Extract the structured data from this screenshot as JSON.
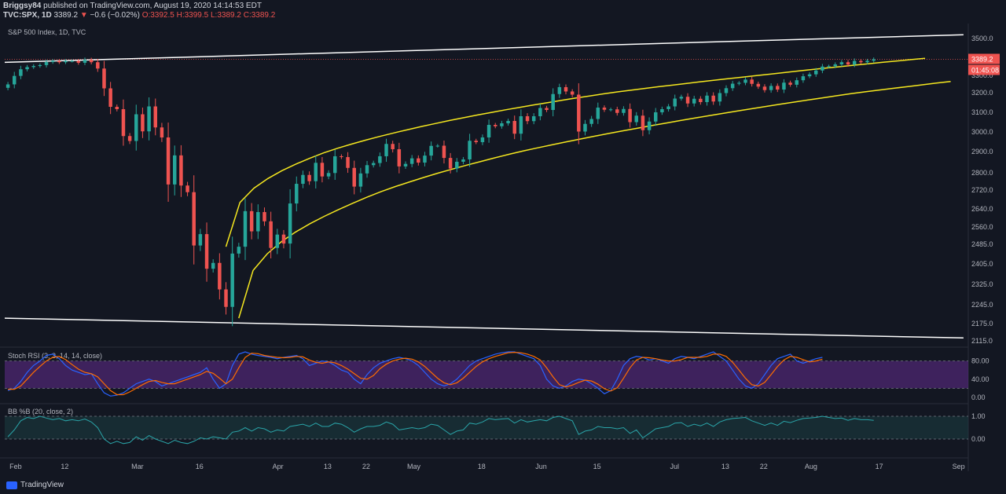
{
  "header": {
    "user": "Briggsy84",
    "published": "published on TradingView.com, August 19, 2020 14:14:53 EDT",
    "symbol": "TVC:SPX, 1D",
    "price": "3389.2",
    "change": "−0.6 (−0.02%)",
    "ohlc_o": "O:3392.5",
    "ohlc_h": "H:3399.5",
    "ohlc_l": "L:3389.2",
    "ohlc_c": "C:3389.2"
  },
  "main_label": "S&P 500 Index, 1D, TVC",
  "rsi_label": "Stoch RSI (3, 3, 14, 14, close)",
  "bb_label": "BB %B (20, close, 2)",
  "price_tag": "3389.2",
  "time_tag": "01:45:08",
  "footer_brand": "TradingView",
  "colors": {
    "up": "#26a69a",
    "down": "#ef5350",
    "trend": "#ffffff",
    "channel": "#f5e71f",
    "rsi_k": "#2962ff",
    "rsi_d": "#ff6d00",
    "rsi_band": "#5b2a86",
    "bb": "#2aa4a8"
  },
  "chart_data": [
    {
      "type": "candlestick",
      "title": "S&P 500 Index, 1D, TVC",
      "y_ticks": [
        3500,
        3400,
        3300,
        3200,
        3100,
        3000,
        2900,
        2800,
        2720,
        2640,
        2560,
        2485,
        2405,
        2325,
        2245,
        2175,
        2115
      ],
      "x_ticks": [
        "Feb",
        "12",
        "Mar",
        "16",
        "Apr",
        "13",
        "22",
        "May",
        "18",
        "Jun",
        "15",
        "Jul",
        "13",
        "22",
        "Aug",
        "17",
        "Sep"
      ],
      "x_tick_idx": [
        0,
        8,
        19,
        29,
        41,
        49,
        55,
        62,
        73,
        82,
        91,
        103,
        111,
        117,
        124,
        135,
        147
      ],
      "last_price": 3389.2,
      "closes": [
        3248,
        3297,
        3334,
        3346,
        3352,
        3357,
        3374,
        3380,
        3373,
        3380,
        3380,
        3370,
        3386,
        3373,
        3338,
        3225,
        3128,
        3116,
        2979,
        2954,
        3090,
        3003,
        3130,
        3023,
        2972,
        2746,
        2882,
        2741,
        2711,
        2480,
        2529,
        2386,
        2409,
        2305,
        2237,
        2447,
        2475,
        2630,
        2541,
        2626,
        2585,
        2470,
        2527,
        2488,
        2663,
        2749,
        2790,
        2761,
        2847,
        2783,
        2799,
        2878,
        2874,
        2823,
        2736,
        2797,
        2836,
        2846,
        2878,
        2939,
        2912,
        2830,
        2842,
        2868,
        2848,
        2881,
        2929,
        2930,
        2870,
        2820,
        2852,
        2863,
        2955,
        2948,
        2972,
        3036,
        3029,
        3044,
        3056,
        2991,
        3080,
        3055,
        3080,
        3122,
        3112,
        3193,
        3232,
        3207,
        3190,
        3002,
        3041,
        3066,
        3124,
        3113,
        3115,
        3097,
        3117,
        3050,
        3083,
        3009,
        3053,
        3100,
        3116,
        3130,
        3170,
        3179,
        3145,
        3169,
        3152,
        3185,
        3155,
        3198,
        3226,
        3252,
        3257,
        3276,
        3251,
        3235,
        3215,
        3239,
        3218,
        3258,
        3246,
        3272,
        3295,
        3306,
        3327,
        3349,
        3351,
        3361,
        3373,
        3360,
        3380,
        3373,
        3381,
        3389
      ]
    },
    {
      "type": "line",
      "title": "Stoch RSI (3, 3, 14, 14, close)",
      "y_ticks": [
        80,
        40,
        0
      ],
      "series": [
        {
          "name": "K",
          "values": [
            15,
            20,
            35,
            55,
            70,
            80,
            92,
            95,
            85,
            70,
            60,
            55,
            50,
            52,
            30,
            10,
            3,
            5,
            10,
            20,
            30,
            35,
            40,
            35,
            25,
            30,
            35,
            40,
            45,
            50,
            55,
            65,
            40,
            20,
            30,
            70,
            95,
            100,
            95,
            92,
            90,
            88,
            85,
            88,
            90,
            92,
            85,
            70,
            75,
            80,
            78,
            70,
            60,
            55,
            40,
            30,
            50,
            65,
            75,
            80,
            85,
            88,
            85,
            80,
            70,
            55,
            40,
            30,
            25,
            30,
            40,
            55,
            70,
            80,
            85,
            90,
            95,
            98,
            100,
            100,
            95,
            90,
            85,
            70,
            40,
            25,
            20,
            25,
            35,
            40,
            38,
            30,
            20,
            8,
            15,
            40,
            70,
            85,
            90,
            88,
            82,
            85,
            80,
            75,
            85,
            90,
            88,
            85,
            90,
            95,
            100,
            90,
            80,
            60,
            40,
            25,
            20,
            30,
            50,
            70,
            85,
            90,
            95,
            80,
            75,
            80,
            85,
            88
          ]
        },
        {
          "name": "D",
          "values": [
            18,
            18,
            25,
            40,
            55,
            68,
            80,
            88,
            90,
            83,
            72,
            62,
            55,
            52,
            45,
            30,
            15,
            6,
            6,
            12,
            20,
            28,
            35,
            37,
            33,
            30,
            30,
            35,
            40,
            45,
            50,
            57,
            53,
            42,
            30,
            40,
            65,
            88,
            97,
            96,
            92,
            90,
            88,
            87,
            88,
            90,
            89,
            82,
            77,
            75,
            78,
            76,
            70,
            62,
            52,
            42,
            40,
            48,
            63,
            73,
            80,
            84,
            86,
            84,
            78,
            68,
            55,
            42,
            32,
            28,
            32,
            42,
            55,
            68,
            78,
            85,
            90,
            94,
            98,
            99,
            98,
            95,
            90,
            82,
            65,
            45,
            28,
            23,
            27,
            33,
            38,
            36,
            29,
            19,
            14,
            21,
            42,
            65,
            82,
            88,
            87,
            85,
            82,
            80,
            80,
            83,
            88,
            88,
            88,
            90,
            95,
            95,
            90,
            77,
            60,
            42,
            28,
            25,
            33,
            50,
            68,
            82,
            90,
            88,
            83,
            78,
            80,
            84
          ]
        }
      ]
    },
    {
      "type": "line",
      "title": "BB %B (20, close, 2)",
      "y_ticks": [
        1.0,
        0.0
      ],
      "series": [
        {
          "name": "%B",
          "values": [
            0.1,
            0.4,
            0.8,
            0.95,
            0.9,
            1.0,
            0.92,
            0.85,
            0.9,
            0.8,
            0.85,
            0.8,
            0.88,
            0.75,
            0.5,
            0.0,
            -0.2,
            -0.1,
            -0.2,
            -0.15,
            0.1,
            -0.05,
            0.15,
            0.0,
            -0.1,
            -0.2,
            -0.05,
            -0.15,
            -0.2,
            -0.1,
            0.05,
            0.0,
            0.1,
            0.05,
            0.0,
            0.3,
            0.35,
            0.5,
            0.35,
            0.5,
            0.45,
            0.3,
            0.4,
            0.35,
            0.55,
            0.6,
            0.65,
            0.55,
            0.7,
            0.55,
            0.55,
            0.7,
            0.65,
            0.5,
            0.3,
            0.45,
            0.55,
            0.55,
            0.6,
            0.75,
            0.65,
            0.4,
            0.45,
            0.5,
            0.45,
            0.5,
            0.65,
            0.6,
            0.4,
            0.2,
            0.35,
            0.4,
            0.7,
            0.65,
            0.75,
            0.9,
            0.85,
            0.88,
            0.9,
            0.7,
            0.85,
            0.75,
            0.8,
            0.85,
            0.8,
            0.95,
            1.0,
            0.9,
            0.8,
            0.2,
            0.35,
            0.4,
            0.55,
            0.5,
            0.5,
            0.45,
            0.5,
            0.25,
            0.4,
            0.05,
            0.25,
            0.45,
            0.5,
            0.55,
            0.7,
            0.72,
            0.55,
            0.65,
            0.58,
            0.7,
            0.55,
            0.75,
            0.85,
            0.9,
            0.92,
            0.95,
            0.8,
            0.7,
            0.6,
            0.7,
            0.6,
            0.78,
            0.72,
            0.82,
            0.9,
            0.92,
            0.95,
            1.0,
            0.95,
            0.9,
            0.92,
            0.82,
            0.9,
            0.85,
            0.85,
            0.82
          ]
        }
      ]
    }
  ]
}
